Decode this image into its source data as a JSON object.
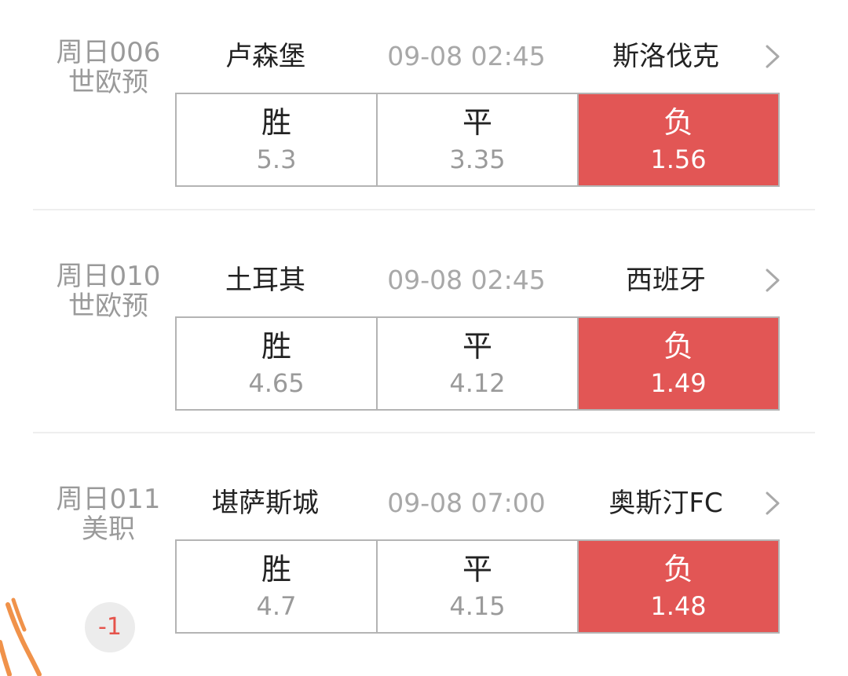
{
  "matches": [
    {
      "code": "周日006",
      "league": "世欧预",
      "handicap": "",
      "home": "卢森堡",
      "time": "09-08 02:45",
      "away": "斯洛伐克",
      "odds": [
        {
          "label": "胜",
          "value": "5.3",
          "selected": false
        },
        {
          "label": "平",
          "value": "3.35",
          "selected": false
        },
        {
          "label": "负",
          "value": "1.56",
          "selected": true
        }
      ]
    },
    {
      "code": "周日010",
      "league": "世欧预",
      "handicap": "",
      "home": "土耳其",
      "time": "09-08 02:45",
      "away": "西班牙",
      "odds": [
        {
          "label": "胜",
          "value": "4.65",
          "selected": false
        },
        {
          "label": "平",
          "value": "4.12",
          "selected": false
        },
        {
          "label": "负",
          "value": "1.49",
          "selected": true
        }
      ]
    },
    {
      "code": "周日011",
      "league": "美职",
      "handicap": "-1",
      "home": "堪萨斯城",
      "time": "09-08 07:00",
      "away": "奥斯汀FC",
      "odds": [
        {
          "label": "胜",
          "value": "4.7",
          "selected": false
        },
        {
          "label": "平",
          "value": "4.15",
          "selected": false
        },
        {
          "label": "负",
          "value": "1.48",
          "selected": true
        }
      ]
    }
  ],
  "icons": {
    "detail": "chevron-right-icon"
  },
  "colors": {
    "selected_bg": "#e25655",
    "handicap_text": "#e5534b",
    "muted_text": "#9a9a9a",
    "pen_mark": "#f0924a"
  }
}
